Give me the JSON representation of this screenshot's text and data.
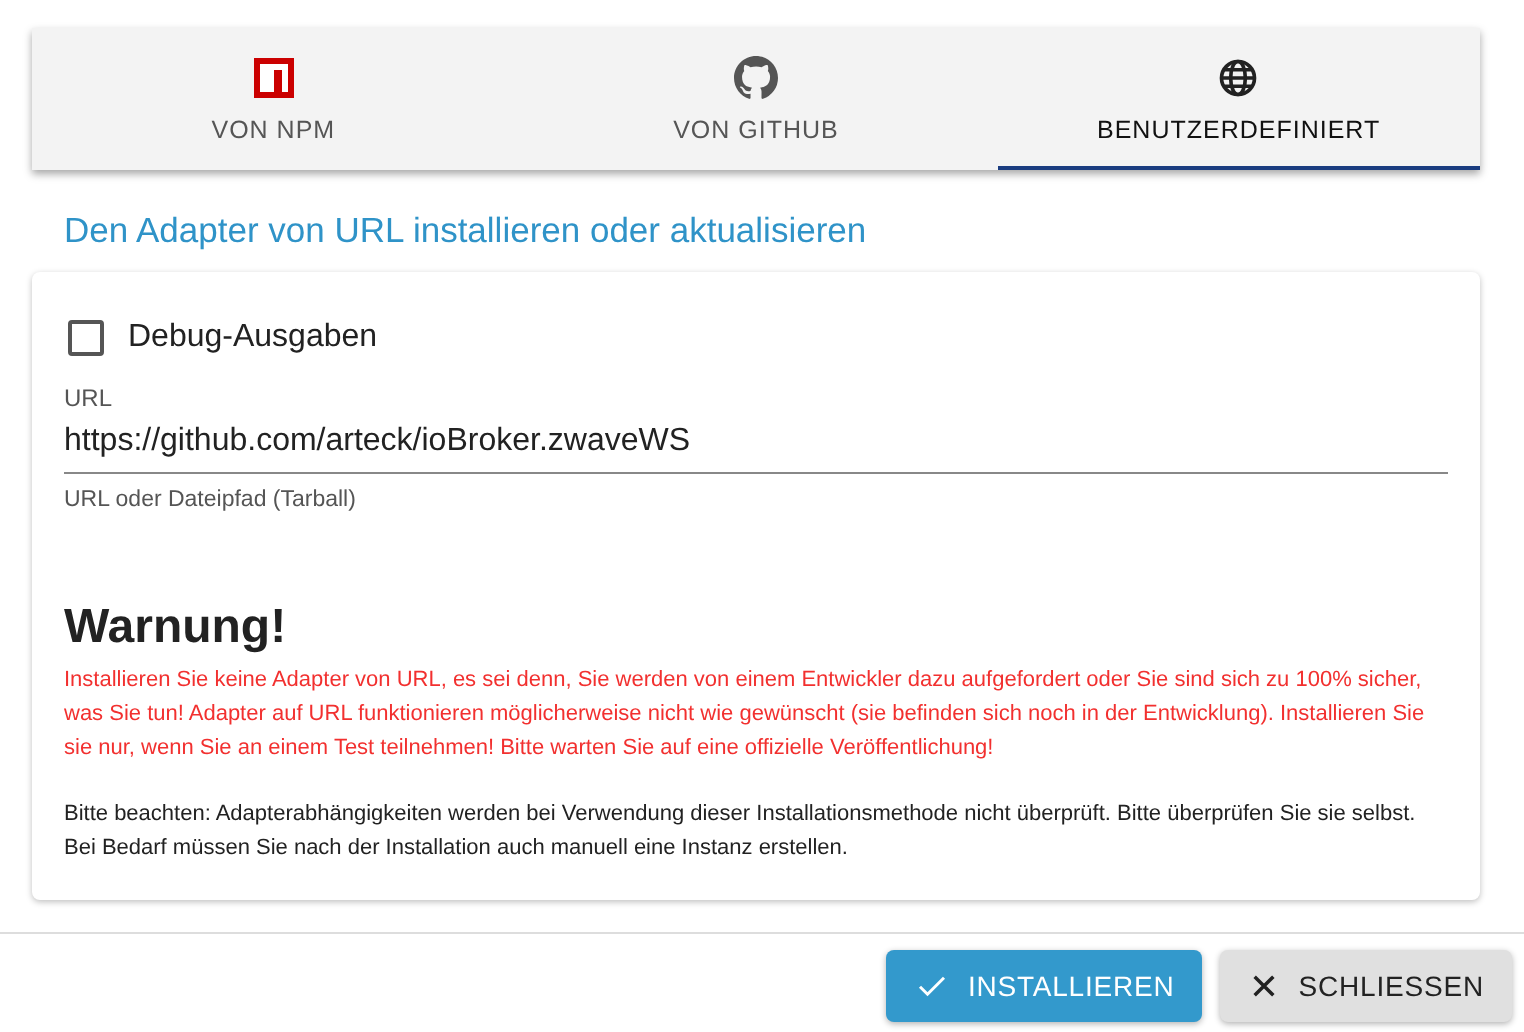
{
  "tabs": [
    {
      "kind": "npm",
      "label": "VON NPM",
      "selected": false
    },
    {
      "kind": "github",
      "label": "VON GITHUB",
      "selected": false
    },
    {
      "kind": "globe",
      "label": "BENUTZERDEFINIERT",
      "selected": true
    }
  ],
  "heading": "Den Adapter von URL installieren oder aktualisieren",
  "debug": {
    "label": "Debug-Ausgaben",
    "checked": false
  },
  "url_field": {
    "label": "URL",
    "value": "https://github.com/arteck/ioBroker.zwaveWS",
    "helper": "URL oder Dateipfad (Tarball)"
  },
  "warning": {
    "title": "Warnung!",
    "text": "Installieren Sie keine Adapter von URL, es sei denn, Sie werden von einem Entwickler dazu aufgefordert oder Sie sind sich zu 100% sicher, was Sie tun! Adapter auf URL funktionieren möglicherweise nicht wie gewünscht (sie befinden sich noch in der Entwicklung). Installieren Sie sie nur, wenn Sie an einem Test teilnehmen! Bitte warten Sie auf eine offizielle Veröffentlichung!"
  },
  "note": "Bitte beachten: Adapterabhängigkeiten werden bei Verwendung dieser Installationsmethode nicht überprüft. Bitte überprüfen Sie sie selbst. Bei Bedarf müssen Sie nach der Installation auch manuell eine Instanz erstellen.",
  "buttons": [
    {
      "kind": "primary",
      "label": "INSTALLIEREN"
    },
    {
      "kind": "secondary",
      "label": "SCHLIESSEN"
    }
  ]
}
